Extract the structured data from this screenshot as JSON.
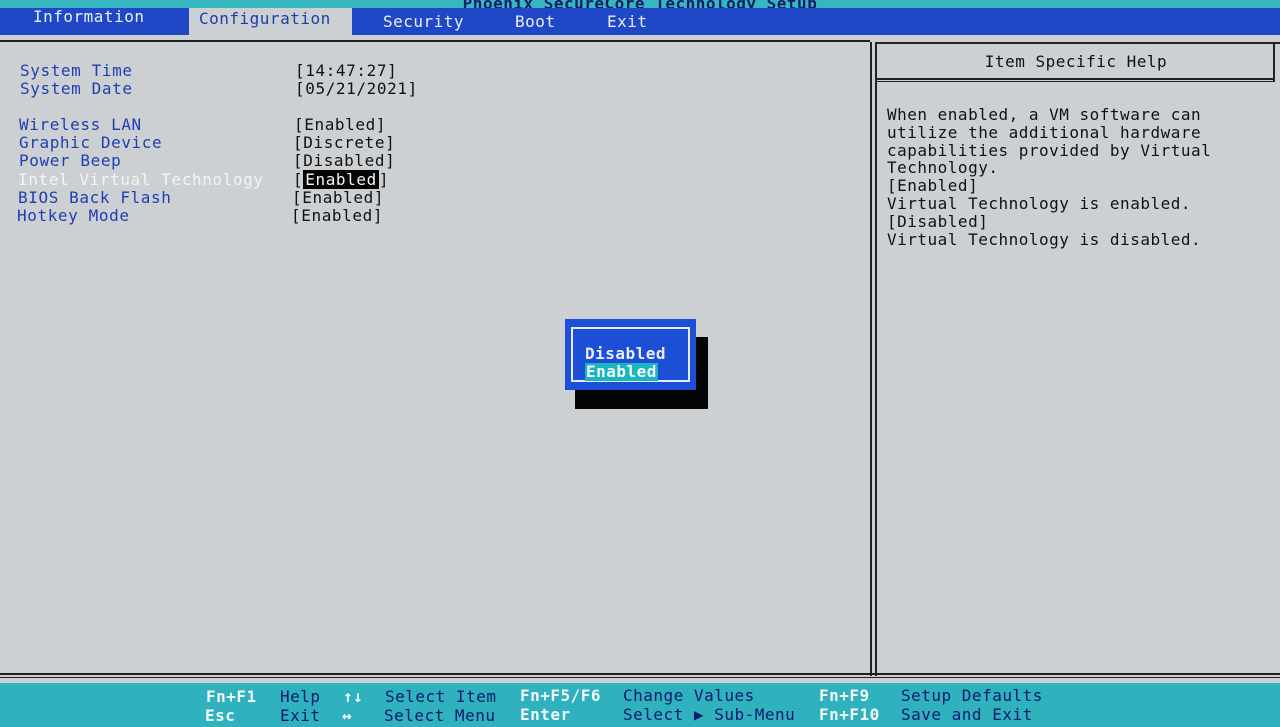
{
  "app": {
    "title": "Phoenix SecureCore Technology Setup"
  },
  "menu": {
    "tabs": [
      {
        "label": "Information"
      },
      {
        "label": "Configuration"
      },
      {
        "label": "Security"
      },
      {
        "label": "Boot"
      },
      {
        "label": "Exit"
      }
    ],
    "active": "Configuration"
  },
  "settings": [
    {
      "label": "System Time",
      "value": "14:47:27"
    },
    {
      "label": "System Date",
      "value": "05/21/2021"
    },
    {
      "label": "Wireless LAN",
      "value": "Enabled"
    },
    {
      "label": "Graphic Device",
      "value": "Discrete"
    },
    {
      "label": "Power Beep",
      "value": "Disabled"
    },
    {
      "label": "Intel Virtual Technology",
      "value": "Enabled"
    },
    {
      "label": "BIOS Back Flash",
      "value": "Enabled"
    },
    {
      "label": "Hotkey Mode",
      "value": "Enabled"
    }
  ],
  "help": {
    "title": "Item Specific Help",
    "lines": [
      "When enabled, a VM software can",
      "utilize the additional hardware",
      "capabilities provided by Virtual",
      "Technology.",
      "[Enabled]",
      "Virtual Technology is enabled.",
      "[Disabled]",
      "Virtual Technology is disabled."
    ]
  },
  "popup": {
    "options": [
      "Disabled",
      "Enabled"
    ],
    "selected": "Enabled"
  },
  "footer": {
    "row1": [
      {
        "key": "Fn+F1",
        "desc": "Help"
      },
      {
        "key": "↑↓",
        "desc": "Select Item"
      },
      {
        "key": "Fn+F5/F6",
        "desc": "Change Values"
      },
      {
        "key": "Fn+F9",
        "desc": "Setup Defaults"
      }
    ],
    "row2": [
      {
        "key": "Esc",
        "desc": "Exit"
      },
      {
        "key": "↔",
        "desc": "Select Menu"
      },
      {
        "key": "Enter",
        "desc": "Select ▶ Sub-Menu"
      },
      {
        "key": "Fn+F10",
        "desc": "Save and Exit"
      }
    ]
  },
  "colors": {
    "menubar": "#1f47c6",
    "footer": "#2fb2bd",
    "label": "#1d3fb0",
    "popup": "#1d4fd6",
    "popup_highlight": "#19b7bd"
  }
}
